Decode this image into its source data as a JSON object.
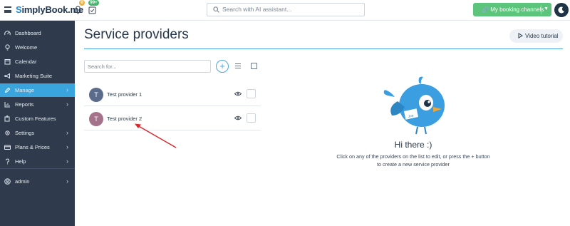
{
  "header": {
    "logo_prefix": "S",
    "logo_text": "implyBook.me",
    "notif_count": "0",
    "tasks_count": "99+",
    "search_placeholder": "Search with AI assistant...",
    "booking_channels_label": "My booking channels"
  },
  "sidebar": {
    "items": [
      {
        "label": "Dashboard",
        "icon": "dashboard-icon"
      },
      {
        "label": "Welcome",
        "icon": "bulb-icon"
      },
      {
        "label": "Calendar",
        "icon": "calendar-icon"
      },
      {
        "label": "Marketing Suite",
        "icon": "megaphone-icon"
      },
      {
        "label": "Manage",
        "icon": "pencil-icon",
        "active": true
      },
      {
        "label": "Reports",
        "icon": "chart-icon"
      },
      {
        "label": "Custom Features",
        "icon": "puzzle-icon"
      },
      {
        "label": "Settings",
        "icon": "gear-icon"
      },
      {
        "label": "Plans & Prices",
        "icon": "card-icon"
      },
      {
        "label": "Help",
        "icon": "help-icon"
      },
      {
        "label": "admin",
        "icon": "user-icon"
      }
    ]
  },
  "main": {
    "title": "Service providers",
    "video_label": "Video tutorial",
    "search_placeholder": "Search for...",
    "add_label": "+",
    "providers": [
      {
        "initial": "T",
        "name": "Test provider 1",
        "color": "#5b6b8c"
      },
      {
        "initial": "T",
        "name": "Test provider 2",
        "color": "#a4728a"
      }
    ]
  },
  "empty_state": {
    "title": "Hi there :)",
    "description": "Click on any of the providers on the list to edit, or press the + button to create a new service provider",
    "sign_text": "Joe"
  },
  "colors": {
    "accent": "#3aa4dd",
    "sidebar_bg": "#2f3b4c",
    "booking_green": "#5cc47b"
  }
}
